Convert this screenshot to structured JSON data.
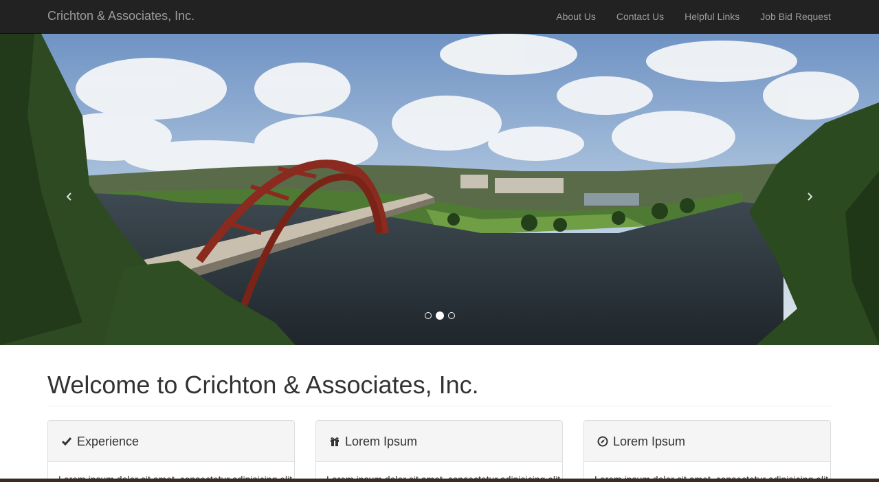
{
  "navbar": {
    "brand": "Crichton & Associates, Inc.",
    "links": [
      "About Us",
      "Contact Us",
      "Helpful Links",
      "Job Bid Request"
    ]
  },
  "carousel": {
    "prev_icon": "chevron-left-icon",
    "next_icon": "chevron-right-icon",
    "slide_count": 3,
    "active_index": 1
  },
  "main": {
    "heading": "Welcome to Crichton & Associates, Inc.",
    "panels": [
      {
        "icon": "check-icon",
        "title": "Experience",
        "body": "Lorem ipsum dolor sit amet, consectetur adipisicing elit."
      },
      {
        "icon": "gift-icon",
        "title": "Lorem Ipsum",
        "body": "Lorem ipsum dolor sit amet, consectetur adipisicing elit."
      },
      {
        "icon": "compass-icon",
        "title": "Lorem Ipsum",
        "body": "Lorem ipsum dolor sit amet, consectetur adipisicing elit."
      }
    ]
  },
  "colors": {
    "navbar_bg": "#222222",
    "nav_text": "#9d9d9d",
    "panel_heading_bg": "#f5f5f5",
    "bridge": "#8b2a1e"
  }
}
